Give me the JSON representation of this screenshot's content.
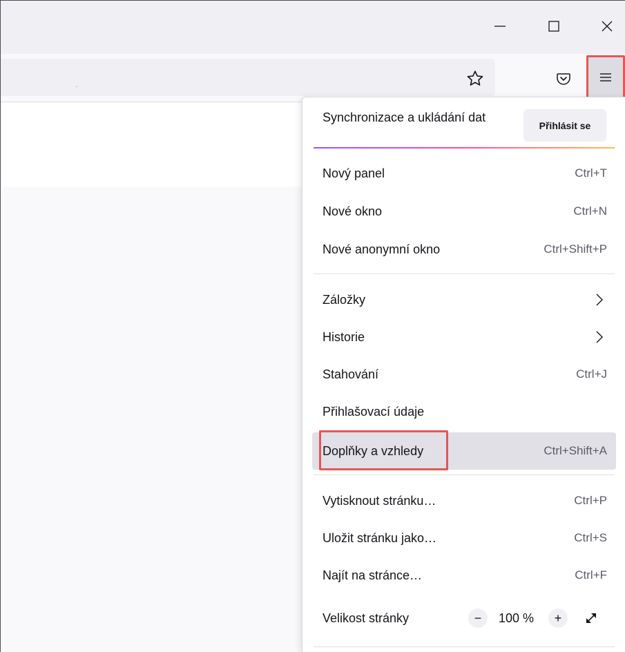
{
  "window": {
    "minimize_icon": "minimize-icon",
    "maximize_icon": "maximize-icon",
    "close_icon": "close-icon"
  },
  "toolbar": {
    "bookmark_icon": "star-icon",
    "pocket_icon": "pocket-icon",
    "menu_icon": "hamburger-menu-icon"
  },
  "menu": {
    "sync_title": "Synchronizace a ukládání dat",
    "signin_label": "Přihlásit se",
    "items": [
      {
        "label": "Nový panel",
        "shortcut": "Ctrl+T"
      },
      {
        "label": "Nové okno",
        "shortcut": "Ctrl+N"
      },
      {
        "label": "Nové anonymní okno",
        "shortcut": "Ctrl+Shift+P"
      },
      {
        "label": "Záložky",
        "submenu": true
      },
      {
        "label": "Historie",
        "submenu": true
      },
      {
        "label": "Stahování",
        "shortcut": "Ctrl+J"
      },
      {
        "label": "Přihlašovací údaje",
        "shortcut": ""
      },
      {
        "label": "Doplňky a vzhledy",
        "shortcut": "Ctrl+Shift+A"
      },
      {
        "label": "Vytisknout stránku…",
        "shortcut": "Ctrl+P"
      },
      {
        "label": "Uložit stránku jako…",
        "shortcut": "Ctrl+S"
      },
      {
        "label": "Najít na stránce…",
        "shortcut": "Ctrl+F"
      }
    ],
    "zoom": {
      "label": "Velikost stránky",
      "minus": "−",
      "value": "100 %",
      "plus": "+"
    }
  },
  "colors": {
    "highlight": "#e55555",
    "hover_bg": "#e0e0e6"
  }
}
